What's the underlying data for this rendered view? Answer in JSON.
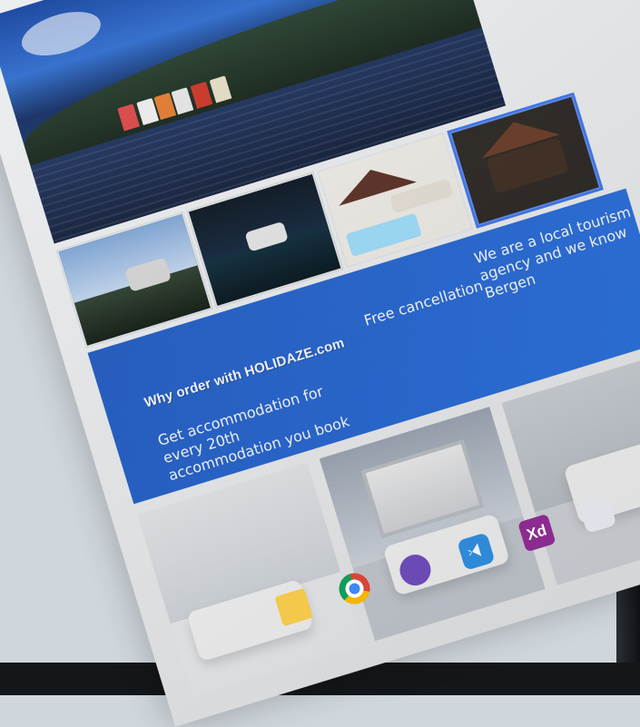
{
  "header": {
    "site_name": "HOLIDAZE.com"
  },
  "hero": {
    "city": "Bergen"
  },
  "thumbnails": [
    {
      "name": "thumb-mountain-view"
    },
    {
      "name": "thumb-night-lake"
    },
    {
      "name": "thumb-pool-deck"
    },
    {
      "name": "thumb-chalet"
    }
  ],
  "cta": {
    "title": "Why order with HOLIDAZE.com",
    "benefits": [
      "Get accommodation for every 20th accommodation you book",
      "Free cancellation",
      "We are a local tourism agency and we know Bergen"
    ]
  },
  "taskbar": {
    "icons": [
      {
        "name": "folder-icon",
        "label": ""
      },
      {
        "name": "chrome-icon",
        "label": ""
      },
      {
        "name": "github-icon",
        "label": ""
      },
      {
        "name": "vscode-icon",
        "label": ""
      },
      {
        "name": "xd-icon",
        "label": "Xd"
      },
      {
        "name": "app-icon",
        "label": ""
      }
    ]
  },
  "colors": {
    "cta_blue": "#2a74e6",
    "page_background": "#eef0f2",
    "selected_border": "#3a78ff"
  }
}
